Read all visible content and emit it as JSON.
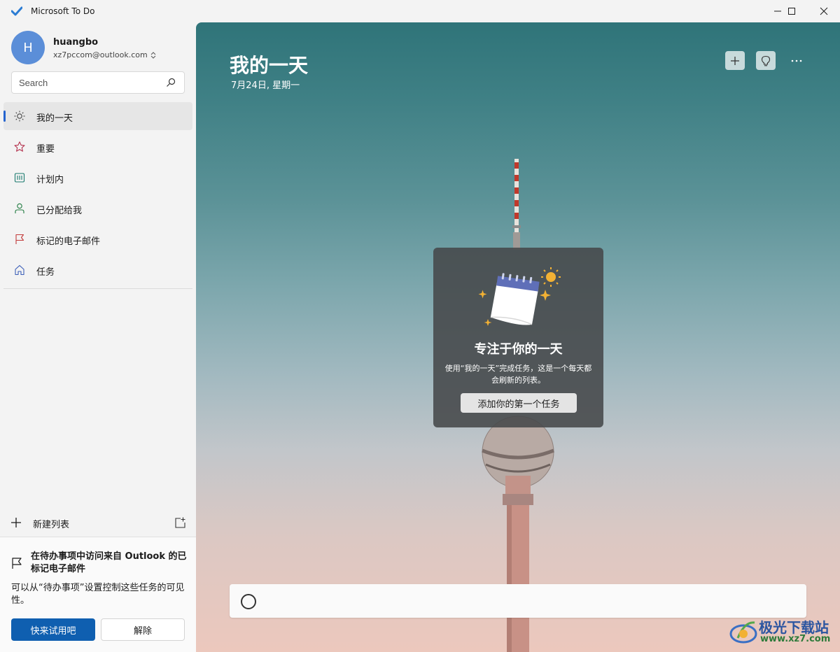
{
  "window": {
    "title": "Microsoft To Do"
  },
  "account": {
    "initial": "H",
    "name": "huangbo",
    "email": "xz7pccom@outlook.com"
  },
  "search": {
    "placeholder": "Search"
  },
  "nav": [
    {
      "label": "我的一天",
      "icon": "sun-icon",
      "active": true
    },
    {
      "label": "重要",
      "icon": "star-icon",
      "active": false
    },
    {
      "label": "计划内",
      "icon": "calendar-grid-icon",
      "active": false
    },
    {
      "label": "已分配给我",
      "icon": "person-icon",
      "active": false
    },
    {
      "label": "标记的电子邮件",
      "icon": "flag-icon",
      "active": false
    },
    {
      "label": "任务",
      "icon": "home-icon",
      "active": false
    }
  ],
  "new_list": {
    "label": "新建列表"
  },
  "promo": {
    "headline": "在待办事项中访问来自 Outlook 的已标记电子邮件",
    "body": "可以从“待办事项”设置控制这些任务的可见性。",
    "primary_button": "快来试用吧",
    "secondary_button": "解除"
  },
  "main": {
    "title": "我的一天",
    "date": "7月24日, 星期一"
  },
  "empty_state": {
    "title": "专注于你的一天",
    "description": "使用“我的一天”完成任务，这是一个每天都会刷新的列表。",
    "button": "添加你的第一个任务"
  },
  "add_task": {
    "placeholder": ""
  },
  "watermark": {
    "name": "极光下载站",
    "url": "www.xz7.com"
  },
  "colors": {
    "accent": "#2564cf",
    "primary_button": "#0f5fb0"
  }
}
